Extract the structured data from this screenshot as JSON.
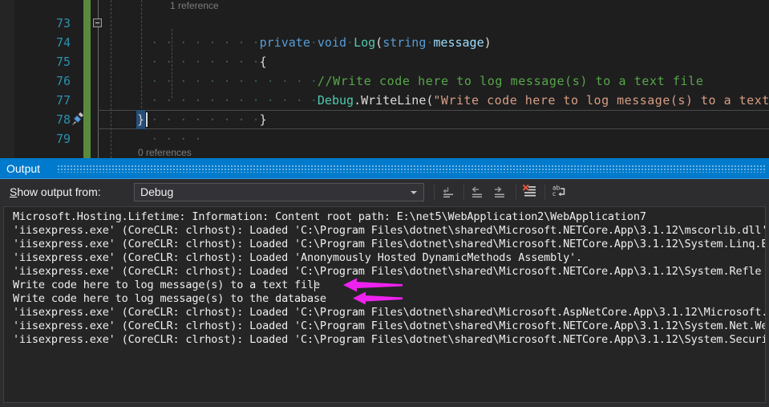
{
  "editor": {
    "codelens_top": "1 reference",
    "codelens_bottom": "0 references",
    "lines": [
      {
        "num": "73",
        "text": "private void Log(string message)"
      },
      {
        "num": "74",
        "text": "{"
      },
      {
        "num": "75",
        "text": "//Write code here to log message(s) to a text file"
      },
      {
        "num": "76",
        "text": "Debug.WriteLine(\"Write code here to log message(s) to a text file\");"
      },
      {
        "num": "77",
        "text": "}"
      },
      {
        "num": "78",
        "text": "}"
      },
      {
        "num": "79",
        "text": ""
      }
    ],
    "tokens": {
      "l73_kw1": "private",
      "l73_kw2": "void",
      "l73_method": "Log",
      "l73_kw3": "string",
      "l73_param": "message",
      "l73_open": "(",
      "l73_close": ")",
      "l74_brace": "{",
      "l75_comment": "//Write code here to log message(s) to a text file",
      "l76_class": "Debug",
      "l76_dot": ".",
      "l76_member": "WriteLine",
      "l76_paren_open": "(",
      "l76_string": "\"Write code here to log message(s) to a text file\"",
      "l76_paren_close": ");",
      "l77_brace": "}",
      "l78_brace": "}"
    },
    "icons": {
      "fold_collapse": "collapse-box-icon",
      "brush": "brush-icon"
    },
    "colors": {
      "keyword": "#569cd6",
      "type": "#4ec9b0",
      "comment": "#57a64a",
      "string": "#d69d85",
      "line_number": "#2b91af",
      "change_bar": "#5a8a3c",
      "selection": "#264f78",
      "background": "#1e1e1e"
    }
  },
  "output_panel": {
    "tab_title": "Output",
    "show_output_from_label_accel": "S",
    "show_output_from_label_rest": "how output from:",
    "selected_source": "Debug",
    "toolbar_buttons": [
      {
        "name": "find-message-icon",
        "title": "Find Message in Code"
      },
      {
        "name": "go-to-previous-message-icon",
        "title": "Go to Previous Message"
      },
      {
        "name": "go-to-next-message-icon",
        "title": "Go to Next Message"
      },
      {
        "name": "clear-all-icon",
        "title": "Clear All"
      },
      {
        "name": "toggle-word-wrap-icon",
        "title": "Toggle Word Wrap"
      }
    ],
    "lines": [
      "Microsoft.Hosting.Lifetime: Information: Content root path: E:\\net5\\WebApplication2\\WebApplication7",
      "'iisexpress.exe' (CoreCLR: clrhost): Loaded 'C:\\Program Files\\dotnet\\shared\\Microsoft.NETCore.App\\3.1.12\\mscorlib.dll'",
      "'iisexpress.exe' (CoreCLR: clrhost): Loaded 'C:\\Program Files\\dotnet\\shared\\Microsoft.NETCore.App\\3.1.12\\System.Linq.E",
      "'iisexpress.exe' (CoreCLR: clrhost): Loaded 'Anonymously Hosted DynamicMethods Assembly'.",
      "'iisexpress.exe' (CoreCLR: clrhost): Loaded 'C:\\Program Files\\dotnet\\shared\\Microsoft.NETCore.App\\3.1.12\\System.Refle",
      "Write code here to log message(s) to a text file",
      "Write code here to log message(s) to the database",
      "'iisexpress.exe' (CoreCLR: clrhost): Loaded 'C:\\Program Files\\dotnet\\shared\\Microsoft.AspNetCore.App\\3.1.12\\Microsoft.",
      "'iisexpress.exe' (CoreCLR: clrhost): Loaded 'C:\\Program Files\\dotnet\\shared\\Microsoft.NETCore.App\\3.1.12\\System.Net.We",
      "'iisexpress.exe' (CoreCLR: clrhost): Loaded 'C:\\Program Files\\dotnet\\shared\\Microsoft.NETCore.App\\3.1.12\\System.Securi"
    ],
    "annotations": [
      {
        "name": "arrow-text-file",
        "color": "#ee22ee",
        "points_to_line": 5
      },
      {
        "name": "arrow-database",
        "color": "#ee22ee",
        "points_to_line": 6
      }
    ],
    "colors": {
      "tab_active": "#007acc",
      "toolbar_bg": "#2d2d30",
      "text_bg": "#252526",
      "text_fg": "#f0f0f0",
      "annotation": "#ee22ee"
    }
  }
}
